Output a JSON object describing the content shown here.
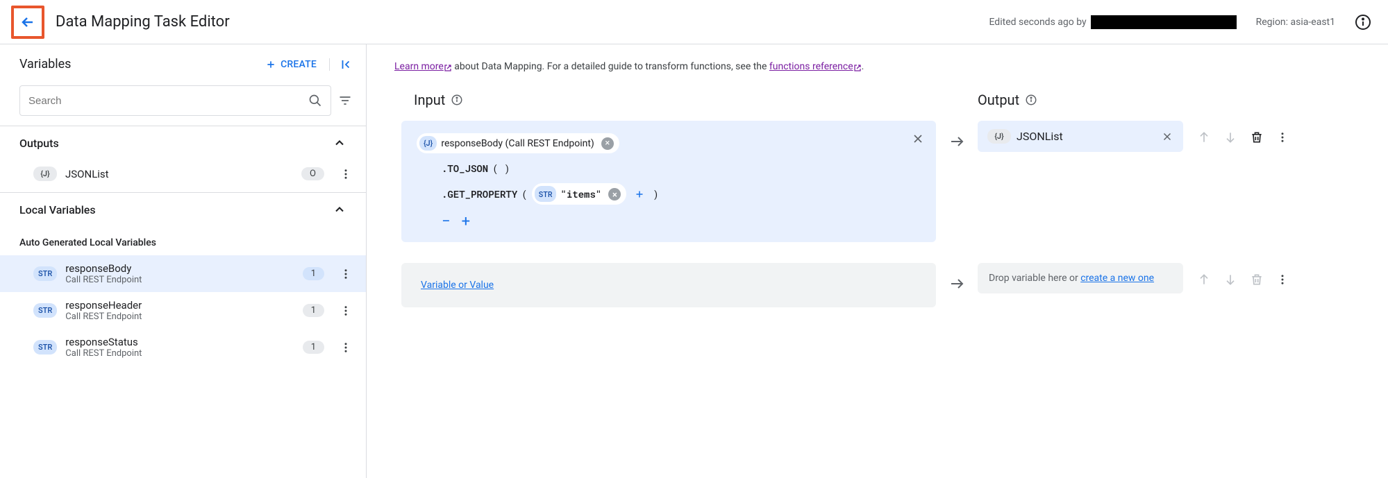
{
  "header": {
    "title": "Data Mapping Task Editor",
    "edited_prefix": "Edited seconds ago by",
    "region_label": "Region:",
    "region_value": "asia-east1"
  },
  "sidebar": {
    "title": "Variables",
    "create_label": "CREATE",
    "search_placeholder": "Search",
    "sections": {
      "outputs": {
        "label": "Outputs",
        "items": [
          {
            "type": "{J}",
            "name": "JSONList",
            "count": "O"
          }
        ]
      },
      "local": {
        "label": "Local Variables",
        "sub_label": "Auto Generated Local Variables",
        "items": [
          {
            "type": "STR",
            "name": "responseBody",
            "sub": "Call REST Endpoint",
            "count": "1",
            "selected": true
          },
          {
            "type": "STR",
            "name": "responseHeader",
            "sub": "Call REST Endpoint",
            "count": "1"
          },
          {
            "type": "STR",
            "name": "responseStatus",
            "sub": "Call REST Endpoint",
            "count": "1"
          }
        ]
      }
    }
  },
  "content": {
    "learn_more": "Learn more",
    "desc_mid": " about Data Mapping. For a detailed guide to transform functions, see the ",
    "func_ref": "functions reference",
    "desc_end": ".",
    "input_label": "Input",
    "output_label": "Output",
    "mapping": {
      "source_chip_type": "{J}",
      "source_chip_label": "responseBody (Call REST Endpoint)",
      "fn1": ".TO_JSON",
      "fn2": ".GET_PROPERTY",
      "arg_type": "STR",
      "arg_value": "\"items\"",
      "output_type": "{J}",
      "output_name": "JSONList"
    },
    "placeholder_input": "Variable or Value",
    "placeholder_output_prefix": "Drop variable here or ",
    "placeholder_output_link": "create a new one"
  }
}
